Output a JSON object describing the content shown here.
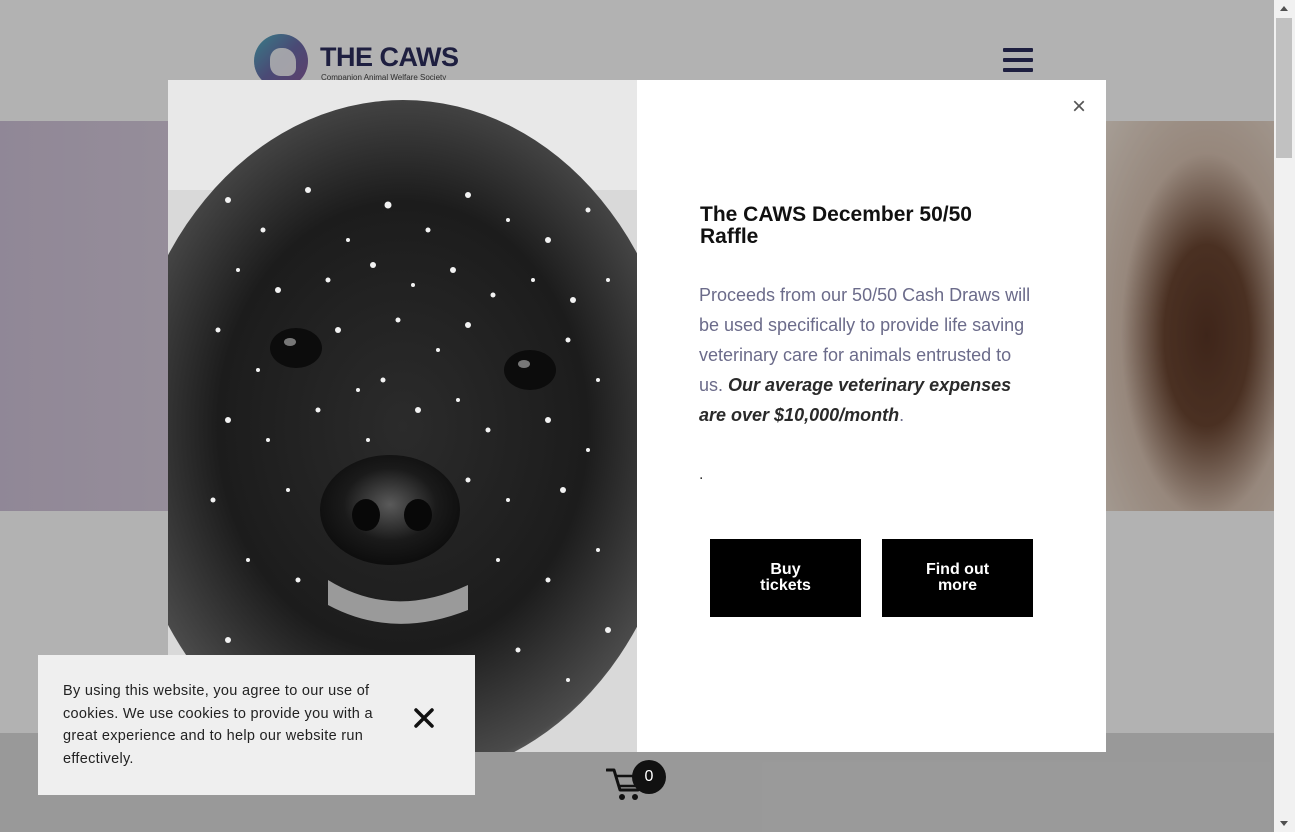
{
  "header": {
    "logo_title": "THE CAWS",
    "logo_subtitle": "Companion Animal Welfare Society"
  },
  "modal": {
    "close_label": "×",
    "title": "The CAWS December 50/50 Raffle",
    "body_plain": "Proceeds from our 50/50 Cash Draws will be used specifically to provide life saving veterinary care for animals entrusted to us.",
    "body_emphasis": "Our average veterinary expenses are over $10,000/month",
    "body_trailing": ".",
    "dot_line": ".",
    "buy_button": "Buy tickets",
    "more_button": "Find out more"
  },
  "cookie": {
    "text": "By using this website, you agree to our use of cookies. We use cookies to provide you with a great experience and to help our website run effectively."
  },
  "cart": {
    "count": "0"
  },
  "colors": {
    "brand_navy": "#2b2d5c",
    "button_bg": "#000000",
    "body_text": "#6b6b8a"
  }
}
